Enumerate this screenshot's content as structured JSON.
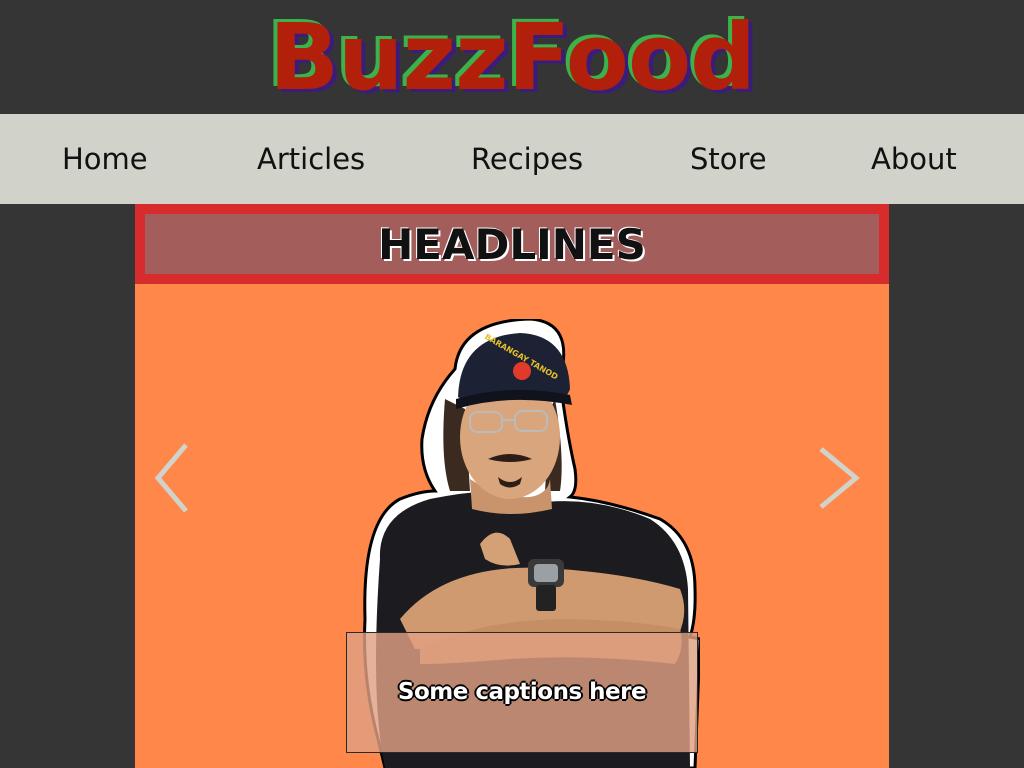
{
  "header": {
    "logo_text": "BuzzFood"
  },
  "nav": {
    "items": [
      {
        "label": "Home"
      },
      {
        "label": "Articles"
      },
      {
        "label": "Recipes"
      },
      {
        "label": "Store"
      },
      {
        "label": "About"
      }
    ]
  },
  "headlines": {
    "title": "HEADLINES"
  },
  "carousel": {
    "prev_icon": "chevron-left-icon",
    "next_icon": "chevron-right-icon",
    "caption": "Some captions here",
    "background_color": "#ff874a"
  },
  "colors": {
    "page_background": "#353535",
    "nav_background": "#d1d2c9",
    "logo_fill": "#b21f0b",
    "logo_shadow_green": "#3bb24a",
    "logo_shadow_purple": "#3a1d7a",
    "headlines_border": "#d82b2b",
    "headlines_fill": "#a35d5b"
  }
}
